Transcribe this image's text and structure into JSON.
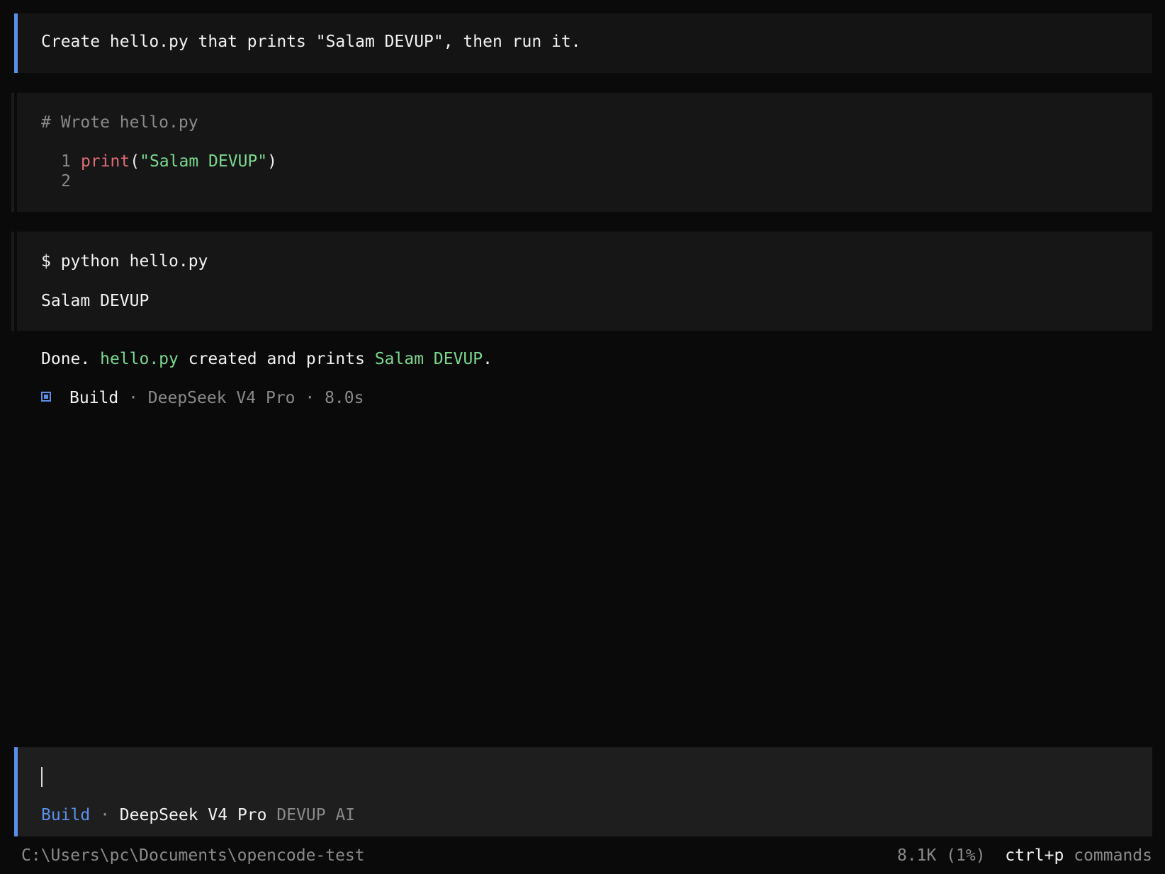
{
  "user_message": "Create hello.py that prints \"Salam DEVUP\", then run it.",
  "write_tool": {
    "header": "# Wrote hello.py",
    "lines": [
      {
        "num": "1",
        "func": "print",
        "open": "(",
        "string": "\"Salam DEVUP\"",
        "close": ")"
      },
      {
        "num": "2"
      }
    ]
  },
  "bash_tool": {
    "command": "$ python hello.py",
    "output": "Salam DEVUP"
  },
  "final": {
    "prefix": "Done. ",
    "file": "hello.py",
    "middle": " created and prints ",
    "value": "Salam DEVUP",
    "suffix": "."
  },
  "meta": {
    "agent": "Build",
    "sep": " · ",
    "model": "DeepSeek V4 Pro",
    "duration": "8.0s"
  },
  "input": {
    "agent": "Build",
    "sep": " · ",
    "model": "DeepSeek V4 Pro",
    "provider": "DEVUP AI"
  },
  "status": {
    "path": "C:\\Users\\pc\\Documents\\opencode-test",
    "tokens": "8.1K (1%)",
    "shortcut_key": "ctrl+p",
    "shortcut_label": "commands"
  },
  "colors": {
    "accent": "#5c8fe8",
    "string": "#7bd88f",
    "keyword": "#e06c75",
    "muted": "#8a8a8a"
  }
}
